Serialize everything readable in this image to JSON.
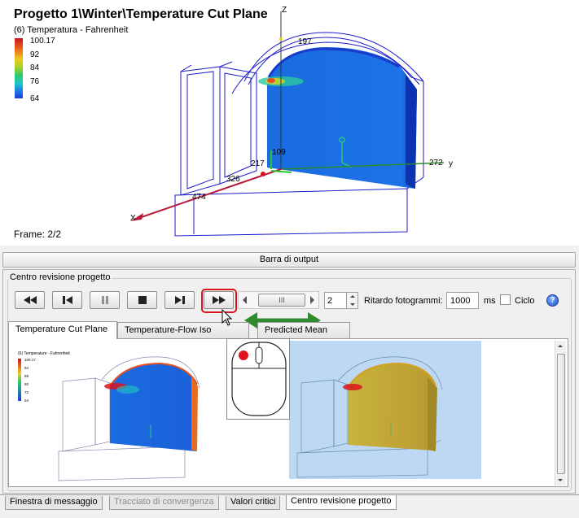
{
  "viewport": {
    "title": "Progetto 1\\Winter\\Temperature Cut Plane",
    "subtitle": "(6) Temperatura - Fahrenheit",
    "legend": [
      "100.17",
      "92",
      "84",
      "76",
      "64"
    ],
    "frame": "Frame: 2/2",
    "axis_labels": {
      "z": "Z",
      "n197": "197",
      "n109": "109",
      "n217": "217",
      "n326": "326",
      "n272": "272",
      "y": "y",
      "n474": "474",
      "x": "X"
    }
  },
  "output_bar": {
    "label": "Barra di output"
  },
  "review": {
    "group_label": "Centro revisione progetto",
    "buttons": {
      "rewind": "rewind",
      "step_back": "step-back",
      "pause": "pause",
      "stop": "stop",
      "step_forward": "step-forward",
      "fast_forward": "fast-forward"
    },
    "slider_thumb": "III",
    "frame_step": "2",
    "delay_label": "Ritardo fotogrammi:",
    "delay_value": "1000",
    "ms_label": "ms",
    "loop_label": "Ciclo",
    "loop_checked": false,
    "help": "?"
  },
  "tabs": [
    {
      "label": "Temperature Cut Plane",
      "active": true
    },
    {
      "label": "Temperature-Flow Iso Surface",
      "active": false
    },
    {
      "label": "Predicted Mean Vote",
      "active": false
    }
  ],
  "bottom_tabs": [
    {
      "label": "Finestra di messaggio",
      "state": "normal"
    },
    {
      "label": "Tracciato di convergenza",
      "state": "disabled"
    },
    {
      "label": "Valori critici",
      "state": "normal"
    },
    {
      "label": "Centro revisione progetto",
      "state": "active"
    }
  ],
  "thumbnail_left": {
    "subtitle": "(6) Temperature - Fahrenheit",
    "legend": [
      "100.17",
      "94",
      "88",
      "80",
      "72",
      "64"
    ]
  },
  "colors": {
    "highlight": "#d8141e",
    "drag_arrow": "#2e8b2e",
    "mouse_button": "#e0141e"
  }
}
